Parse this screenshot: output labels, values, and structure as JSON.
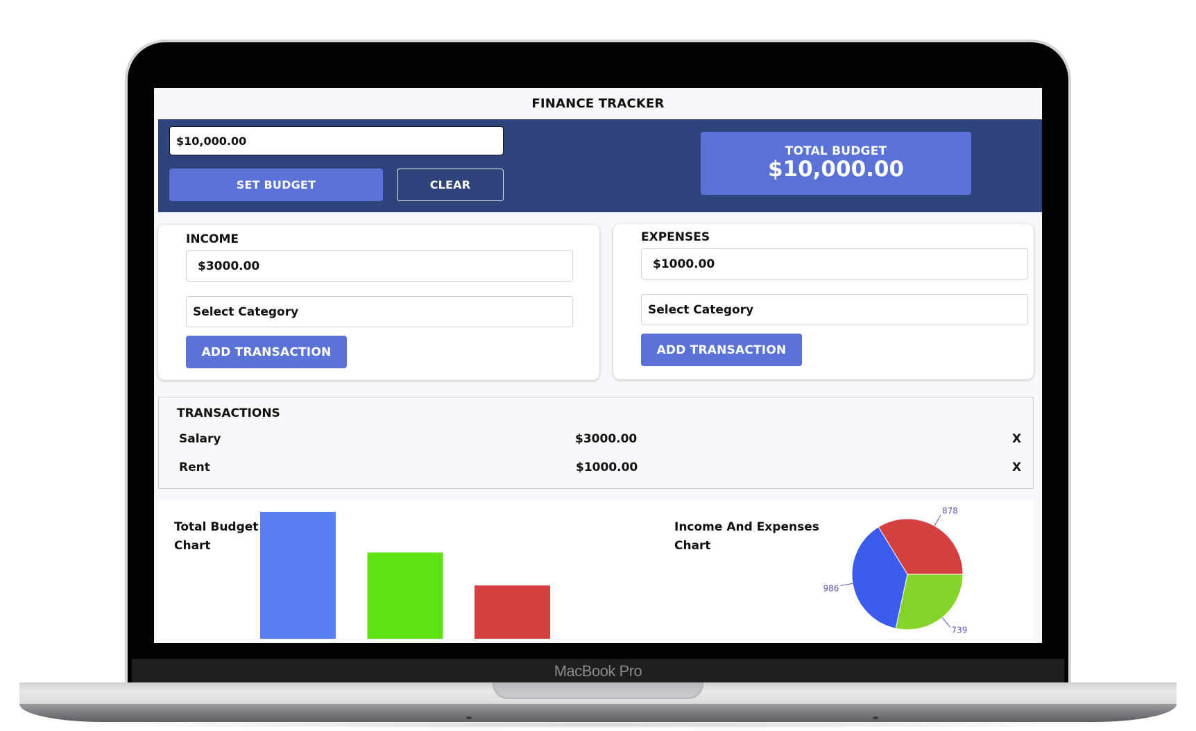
{
  "device": {
    "brand_label": "MacBook Pro"
  },
  "app": {
    "title": "FINANCE TRACKER"
  },
  "budget": {
    "input_value": "$10,000.00",
    "set_budget_label": "SET BUDGET",
    "clear_label": "CLEAR",
    "total_label": "TOTAL BUDGET",
    "total_value": "$10,000.00"
  },
  "income": {
    "title": "INCOME",
    "amount_value": "$3000.00",
    "category_placeholder": "Select Category",
    "add_label": "ADD TRANSACTION"
  },
  "expenses": {
    "title": "EXPENSES",
    "amount_value": "$1000.00",
    "category_placeholder": "Select Category",
    "add_label": "ADD TRANSACTION"
  },
  "transactions": {
    "title": "TRANSACTIONS",
    "rows": [
      {
        "name": "Salary",
        "amount": "$3000.00",
        "delete_label": "X"
      },
      {
        "name": "Rent",
        "amount": "$1000.00",
        "delete_label": "X"
      }
    ]
  },
  "colors": {
    "band": "#2e447b",
    "primary": "#5a72d5",
    "bar_blue": "#5880f2",
    "bar_green": "#5fe317",
    "bar_red": "#d44040",
    "pie_red": "#d44040",
    "pie_green": "#86d42a",
    "pie_blue": "#3a5bed",
    "pie_label": "#5a54b0"
  },
  "chart_data": [
    {
      "type": "bar",
      "title": "Total Budget Chart",
      "categories": [
        "",
        "",
        ""
      ],
      "values_relative": [
        100,
        68,
        42
      ],
      "colors": [
        "#5880f2",
        "#5fe317",
        "#d44040"
      ],
      "note": "visible bar heights relative to tallest bar; chart bottom/axis clipped, no tick labels shown",
      "xlabel": "",
      "ylabel": "",
      "grid": false,
      "legend": "none"
    },
    {
      "type": "pie",
      "title": "Income And Expenses Chart",
      "slices": [
        {
          "label": "739",
          "value": 739,
          "color": "#86d42a"
        },
        {
          "label": "986",
          "value": 986,
          "color": "#3a5bed"
        },
        {
          "label": "878",
          "value": 878,
          "color": "#d44040"
        }
      ],
      "legend": "none"
    }
  ]
}
